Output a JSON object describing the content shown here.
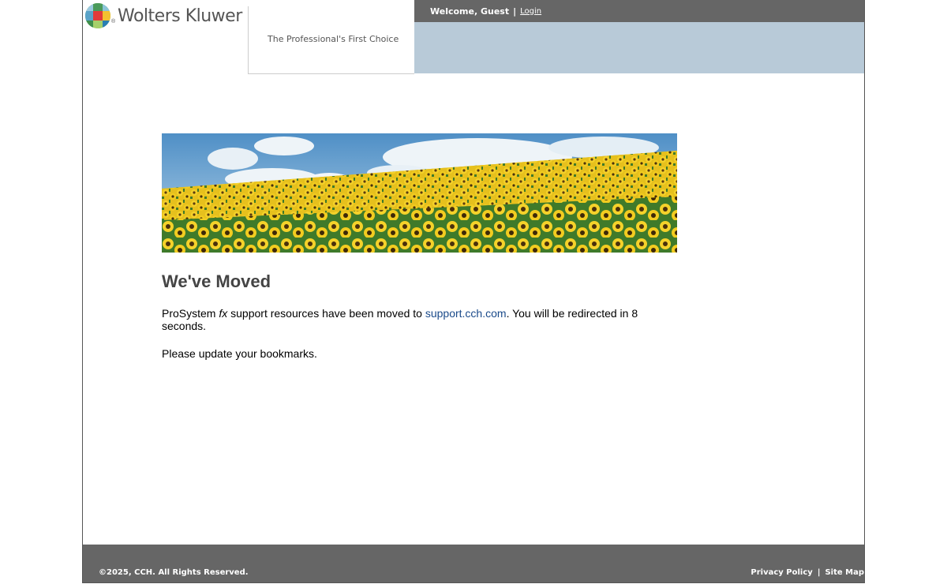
{
  "header": {
    "logo_text": "Wolters Kluwer",
    "logo_reg": "®",
    "tagline": "The Professional's First Choice",
    "welcome": "Welcome, Guest",
    "separator": "|",
    "login_label": "Login"
  },
  "main": {
    "heading": "We've Moved",
    "message_prefix": "ProSystem ",
    "message_italic": "fx",
    "message_mid": " support resources have been moved to ",
    "link_text": "support.cch.com",
    "message_suffix": ". You will be redirected in 8 seconds.",
    "bookmark_text": "Please update your bookmarks."
  },
  "footer": {
    "copyright": "©2025, CCH. All Rights Reserved.",
    "privacy_label": "Privacy Policy",
    "separator": "|",
    "sitemap_label": "Site Map"
  },
  "colors": {
    "topbar": "#666666",
    "bluebar": "#b8cad8",
    "link": "#1a4a8a",
    "heading": "#444444"
  }
}
